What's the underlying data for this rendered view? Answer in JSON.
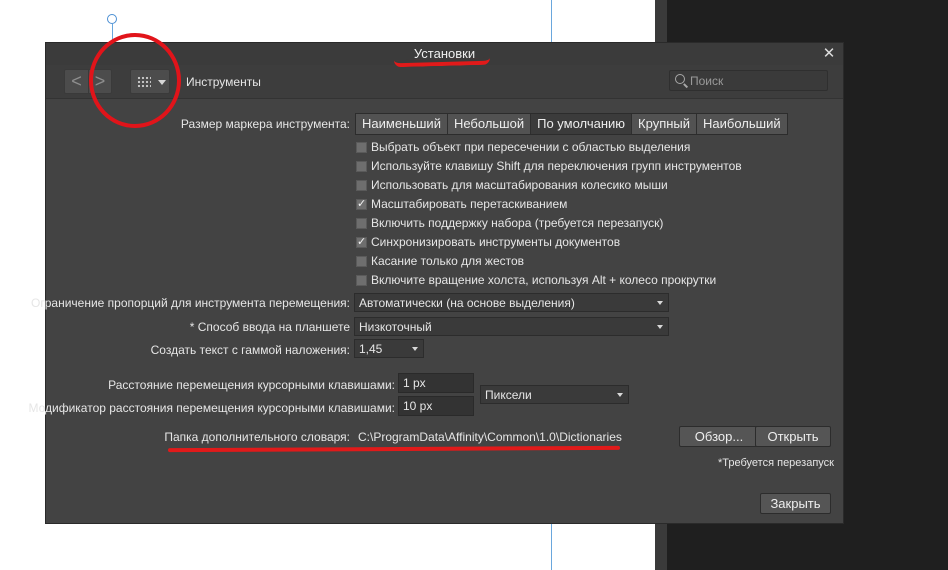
{
  "dialog": {
    "title": "Установки",
    "close_glyph": "✕",
    "colors": {
      "background": "#434343",
      "titlebar": "#3b3b3b",
      "annotation": "#e1141a"
    }
  },
  "toolbar": {
    "back_glyph": "<",
    "forward_glyph": ">",
    "section_label": "Инструменты",
    "search_placeholder": "Поиск",
    "icons": [
      "chevron-left-icon",
      "chevron-right-icon",
      "grid-icon",
      "caret-down-icon",
      "search-icon"
    ]
  },
  "marker_size": {
    "label": "Размер маркера инструмента:",
    "options": [
      "Наименьший",
      "Небольшой",
      "По умолчанию",
      "Крупный",
      "Наибольший"
    ],
    "selected": "По умолчанию"
  },
  "checkboxes": [
    {
      "label": "Выбрать объект при пересечении с областью выделения",
      "checked": false
    },
    {
      "label": "Используйте клавишу Shift для переключения групп инструментов",
      "checked": false
    },
    {
      "label": "Использовать для масштабирования колесико мыши",
      "checked": false
    },
    {
      "label": "Масштабировать перетаскиванием",
      "checked": true
    },
    {
      "label": "Включить поддержку набора (требуется перезапуск)",
      "checked": false
    },
    {
      "label": "Синхронизировать инструменты документов",
      "checked": true
    },
    {
      "label": "Касание только для жестов",
      "checked": false
    },
    {
      "label": "Включите вращение холста, используя Alt + колесо прокрутки",
      "checked": false
    }
  ],
  "proportion": {
    "label": "Ограничение пропорций для инструмента перемещения:",
    "value": "Автоматически (на основе выделения)"
  },
  "tablet": {
    "label": "* Способ ввода на планшете",
    "value": "Низкоточный"
  },
  "gamma": {
    "label": "Создать текст с гаммой наложения:",
    "value": "1,45"
  },
  "cursor_distance": {
    "label": "Расстояние перемещения курсорными клавишами:",
    "value": "1 px"
  },
  "cursor_modifier": {
    "label": "Модификатор расстояния перемещения курсорными клавишами:",
    "value": "10 px"
  },
  "units": {
    "value": "Пиксели"
  },
  "dictionary": {
    "label": "Папка дополнительного словаря:",
    "path": "C:\\ProgramData\\Affinity\\Common\\1.0\\Dictionaries",
    "browse_label": "Обзор...",
    "open_label": "Открыть"
  },
  "restart_note": "*Требуется перезапуск",
  "close_label": "Закрыть"
}
